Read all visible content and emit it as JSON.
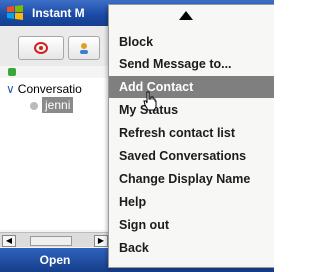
{
  "window": {
    "title": "Instant M"
  },
  "tree": {
    "group_label": "Conversatio",
    "contact_name": "jenni"
  },
  "softkeys": {
    "left_label": "Open"
  },
  "menu": {
    "items": [
      {
        "label": "Block"
      },
      {
        "label": "Send Message to..."
      },
      {
        "label": "Add Contact",
        "highlighted": true
      },
      {
        "label": "My Status"
      },
      {
        "label": "Refresh contact list"
      },
      {
        "label": "Saved Conversations"
      },
      {
        "label": "Change Display Name"
      },
      {
        "label": "Help"
      },
      {
        "label": "Sign out"
      },
      {
        "label": "Back"
      }
    ]
  },
  "colors": {
    "titlebar": "#1a4aa3",
    "menu_highlight": "#7f7f7f",
    "menu_background": "#f7f7f5",
    "status_green": "#3aa73a"
  },
  "icons": {
    "app": "windows-flag-icon",
    "tab1": "messenger-icon",
    "tab2": "contacts-icon"
  }
}
